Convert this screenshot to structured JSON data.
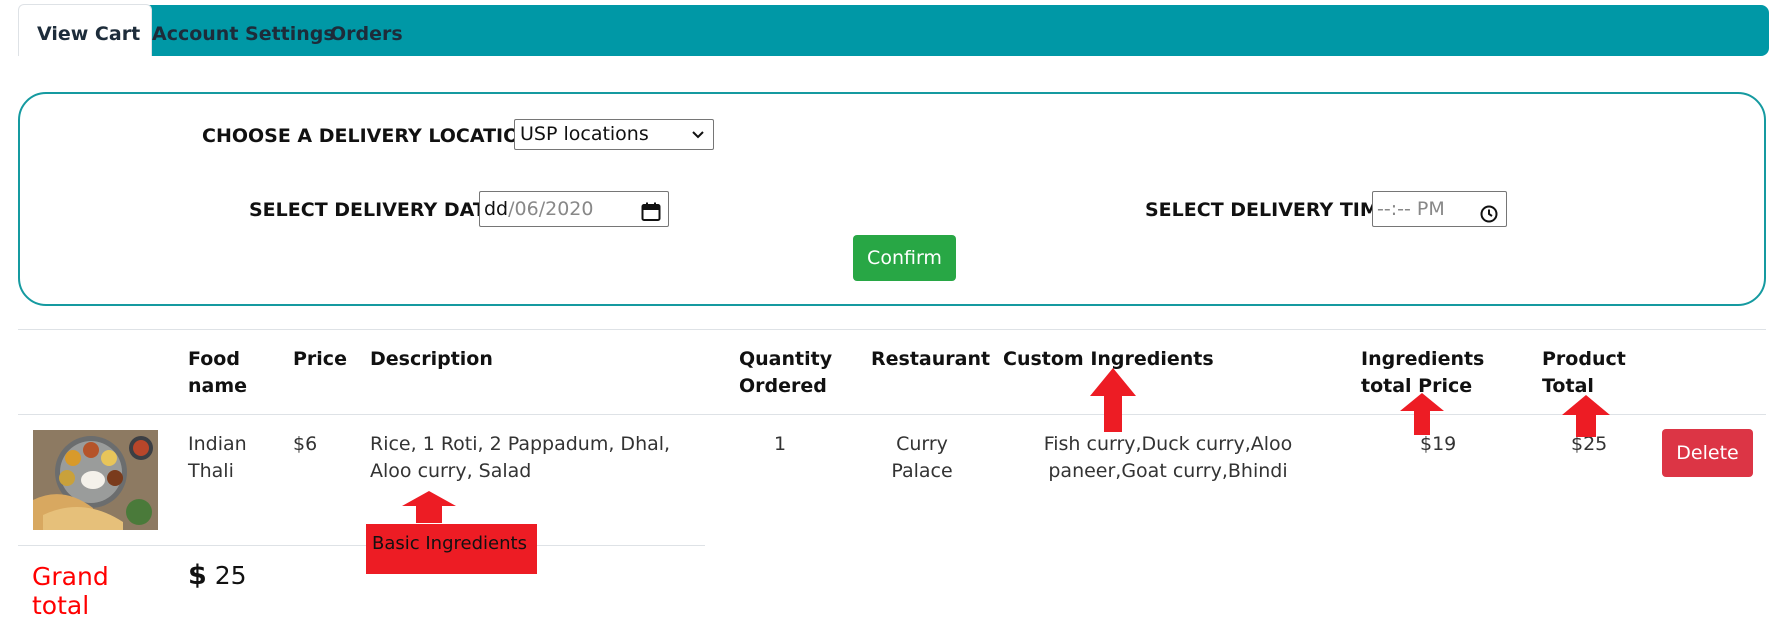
{
  "nav": {
    "tabs": [
      {
        "label": "View Cart",
        "active": true
      },
      {
        "label": "Account Settings",
        "active": false
      },
      {
        "label": "Orders",
        "active": false
      }
    ],
    "bg_color": "#0098a6"
  },
  "delivery": {
    "location_label": "CHOOSE A DELIVERY LOCATION:",
    "location_value": "USP locations",
    "date_label": "SELECT DELIVERY DATE:",
    "date_day": "dd",
    "date_rest": "/06/2020",
    "time_label": "SELECT DELIVERY TIME:",
    "time_value": "--:-- PM",
    "confirm_label": "Confirm"
  },
  "table": {
    "headers": {
      "food_name_1": "Food",
      "food_name_2": "name",
      "price": "Price",
      "description": "Description",
      "quantity_1": "Quantity",
      "quantity_2": "Ordered",
      "restaurant": "Restaurant",
      "custom": "Custom Ingredients",
      "ing_price_1": "Ingredients",
      "ing_price_2": "total Price",
      "product_total_1": "Product",
      "product_total_2": "Total"
    },
    "rows": [
      {
        "image": "thali-food-photo",
        "name_1": "Indian",
        "name_2": "Thali",
        "price": "$6",
        "desc_1": "Rice, 1 Roti, 2 Pappadum, Dhal,",
        "desc_2": "Aloo curry, Salad",
        "quantity": "1",
        "restaurant_1": "Curry",
        "restaurant_2": "Palace",
        "custom_1": "Fish curry,Duck curry,Aloo",
        "custom_2": "paneer,Goat curry,Bhindi",
        "ing_price": "$19",
        "product_total": "$25",
        "delete_label": "Delete"
      }
    ]
  },
  "annotation": {
    "label": "Basic Ingredients",
    "color": "#ed1c24"
  },
  "grand_total": {
    "label": "Grand total",
    "symbol": "$",
    "value": "25"
  },
  "colors": {
    "confirm": "#28a745",
    "delete": "#dc3545",
    "grand_label": "#ff0000",
    "form_border": "#159aa0"
  }
}
